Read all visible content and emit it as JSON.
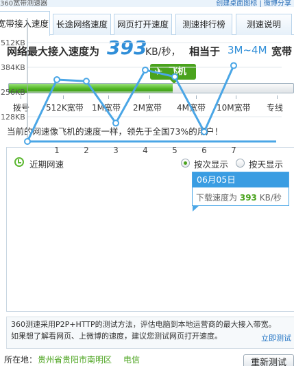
{
  "app": {
    "title": "360宽带测速器",
    "top_links": "创建桌面图标 | 微博分享"
  },
  "tabs": [
    {
      "label": "宽带接入速度",
      "active": true
    },
    {
      "label": "长途网络速度",
      "active": false
    },
    {
      "label": "网页打开速度",
      "active": false
    },
    {
      "label": "测速排行榜",
      "active": false
    },
    {
      "label": "测速说明",
      "active": false
    }
  ],
  "result": {
    "prefix": "网络最大接入速度为",
    "value": "393",
    "unit": "KB/秒，",
    "equiv_prefix": "相当于",
    "range": "3M~4M",
    "suffix": "宽带"
  },
  "badge": {
    "icon": "airplane-icon",
    "label": "飞机",
    "color": "#4aa31d"
  },
  "speed_bar": {
    "fill_fraction": 0.575,
    "ticks": [
      "拨号",
      "512K宽带",
      "1M宽带",
      "2M宽带",
      "4M宽带",
      "10M宽带",
      "专线"
    ]
  },
  "compare_text": "当前的网速像飞机的速度一样，领先于全国73%的用户！",
  "history": {
    "title": "近期网速",
    "options": [
      {
        "label": "按次显示",
        "selected": true
      },
      {
        "label": "按天显示",
        "selected": false
      }
    ],
    "tooltip": {
      "date": "06月05日",
      "label": "下载速度为",
      "value": "393",
      "unit": "KB/秒"
    }
  },
  "chart_data": {
    "type": "line",
    "x": [
      1,
      2,
      3,
      4,
      5,
      6,
      7
    ],
    "y_ticks": [
      "512KB",
      "384KB",
      "256KB",
      "128KB"
    ],
    "ylim": [
      0,
      640
    ],
    "series": [
      {
        "values": [
          320,
          312,
          95,
          370,
          335,
          50,
          393
        ]
      }
    ],
    "color": "#4aa6e6"
  },
  "info": {
    "line1": "360测速采用P2P+HTTP的测试方法，评估电脑到本地运营商的最大接入带宽。",
    "line2": "如果想了解看网页、上微博的速度，建议您测试网页打开速度。",
    "link": "立即测试"
  },
  "footer": {
    "location_label": "所在地：",
    "location": "贵州省贵阳市南明区",
    "isp": "电信",
    "retest_button": "重新测试"
  }
}
